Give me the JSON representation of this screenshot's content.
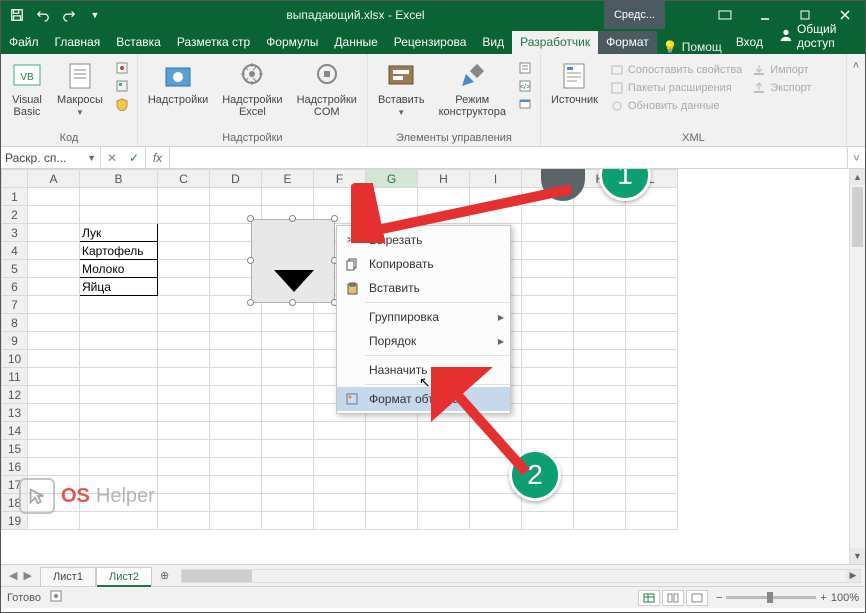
{
  "title": "выпадающий.xlsx - Excel",
  "tools_tab": "Средс...",
  "tabs": {
    "file": "Файл",
    "list": [
      "Главная",
      "Вставка",
      "Разметка стр",
      "Формулы",
      "Данные",
      "Рецензирова",
      "Вид"
    ],
    "active": "Разработчик",
    "format": "Формат",
    "help_placeholder": "Помощ",
    "signin": "Вход",
    "share": "Общий доступ"
  },
  "ribbon": {
    "code": {
      "visual_basic": "Visual\nBasic",
      "macros": "Макросы",
      "caption": "Код"
    },
    "addins": {
      "addins": "Надстройки",
      "excel": "Надстройки\nExcel",
      "com": "Надстройки\nCOM",
      "caption": "Надстройки"
    },
    "controls": {
      "insert": "Вставить",
      "design": "Режим\nконструктора",
      "caption": "Элементы управления"
    },
    "xml": {
      "source": "Источник",
      "map_props": "Сопоставить свойства",
      "packs": "Пакеты расширения",
      "refresh": "Обновить данные",
      "import": "Импорт",
      "export": "Экспорт",
      "caption": "XML"
    }
  },
  "namebox": "Раскр. сп...",
  "fx_label": "fx",
  "columns": [
    "A",
    "B",
    "C",
    "D",
    "E",
    "F",
    "G",
    "H",
    "I",
    "J",
    "K",
    "L"
  ],
  "selected_col": "G",
  "row_count": 19,
  "cells": {
    "B3": "Лук",
    "B4": "Картофель",
    "B5": "Молоко",
    "B6": "Яйца"
  },
  "context_menu": {
    "cut": "Вырезать",
    "copy": "Копировать",
    "paste": "Вставить",
    "group": "Группировка",
    "order": "Порядок",
    "assign_macro": "Назначить макрос...",
    "format_object": "Формат объекта..."
  },
  "sheets": {
    "s1": "Лист1",
    "s2": "Лист2"
  },
  "status": {
    "ready": "Готово",
    "zoom": "100%"
  },
  "annotations": {
    "a1": "1",
    "a2": "2"
  },
  "watermark": {
    "t1": "OS",
    "t2": "Helper"
  }
}
